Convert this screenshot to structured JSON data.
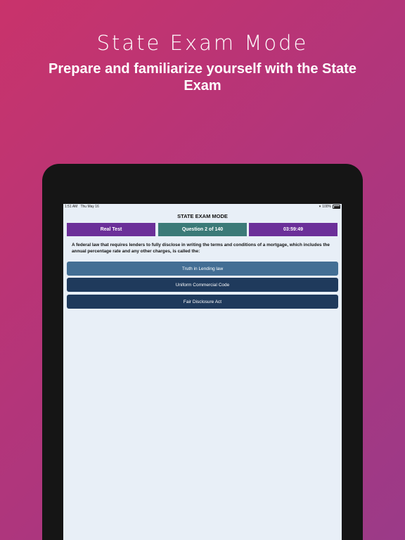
{
  "promo": {
    "headline": "State Exam Mode",
    "subheadline": "Prepare and familiarize yourself with the State Exam"
  },
  "status_bar": {
    "time": "1:51 AM",
    "date": "Thu May 16",
    "battery": "100%",
    "wifi_icon": "wifi-icon",
    "battery_icon": "battery-icon"
  },
  "app": {
    "title": "STATE EXAM MODE",
    "mode_label": "Real Test",
    "progress_label": "Question 2 of 140",
    "timer": "03:59:49",
    "question": "A federal law that requires lenders to fully disclose in writing the terms and conditions of a mortgage, which includes the annual percentage rate and any other charges, is called the:",
    "answers": [
      {
        "label": "Truth in Lending law",
        "selected": true
      },
      {
        "label": "Uniform Commercial Code",
        "selected": false
      },
      {
        "label": "Fair Disclosure Act",
        "selected": false
      }
    ],
    "colors": {
      "mode_box": "#6b2f99",
      "progress_box": "#3b7a78",
      "timer_box": "#6b2f99",
      "answer_selected": "#436e94",
      "answer_normal": "#1f3a5c",
      "screen_bg": "#e8eff7"
    }
  }
}
